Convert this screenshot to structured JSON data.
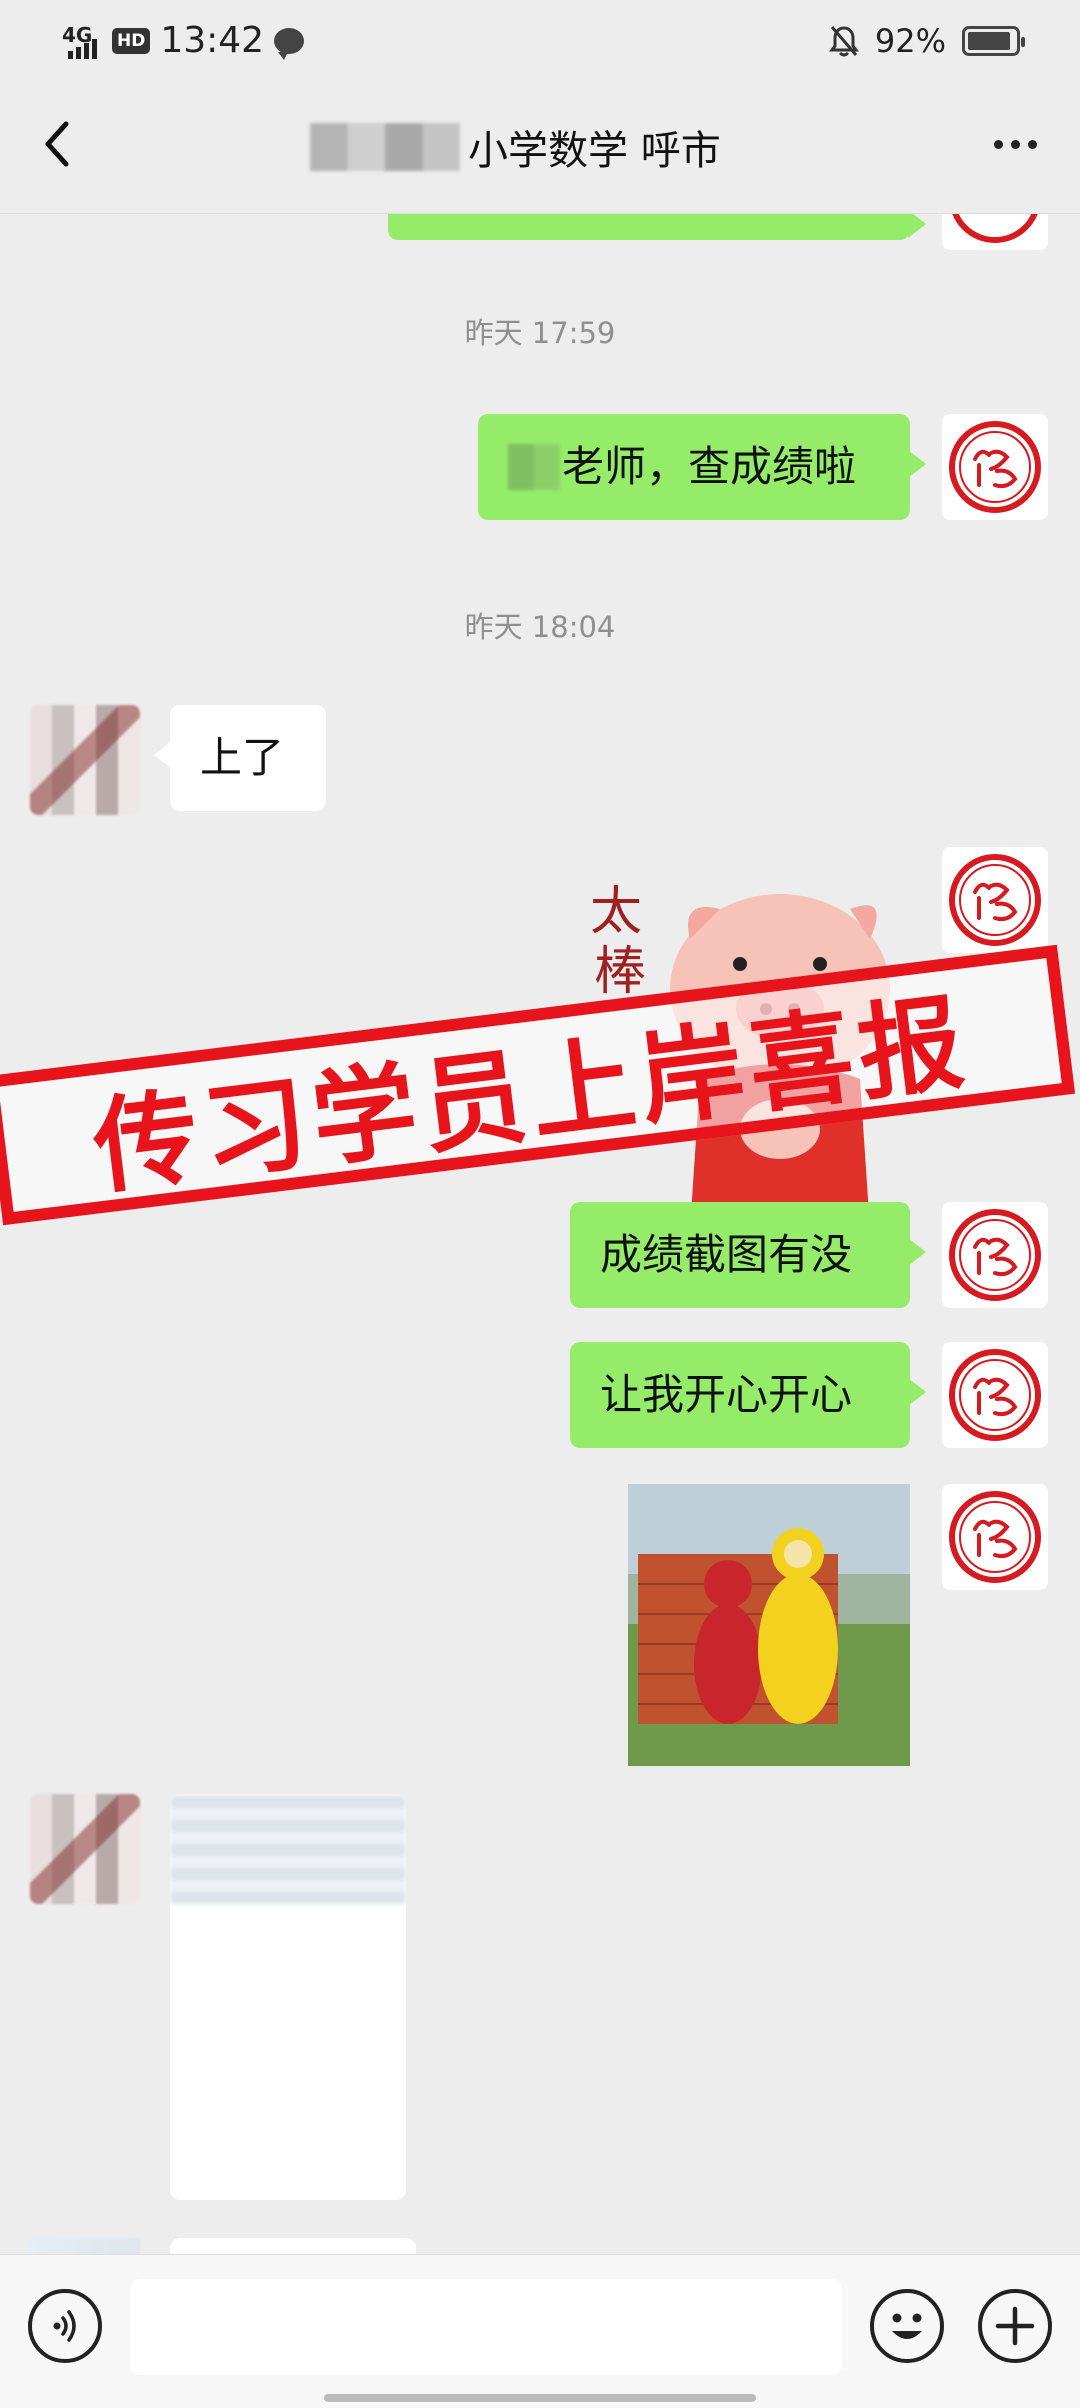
{
  "status_bar": {
    "network": "4G",
    "hd": "HD",
    "time": "13:42",
    "battery_pct": "92%",
    "battery_level": 0.92
  },
  "nav": {
    "title": "小学数学 呼市"
  },
  "messages": {
    "ts1": "昨天 17:59",
    "m1": "老师，查成绩啦",
    "ts2": "昨天 18:04",
    "m2": "上了",
    "m3": "成绩截图有没",
    "m4": "让我开心开心"
  },
  "sticker": {
    "text_visible": "太棒了"
  },
  "stamp": {
    "text": "传习学员上岸喜报"
  },
  "avatar": {
    "label": "传习"
  },
  "colors": {
    "bubble_out": "#95ec69",
    "bubble_in": "#ffffff",
    "background": "#ededed",
    "stamp_red": "#e8141c"
  }
}
